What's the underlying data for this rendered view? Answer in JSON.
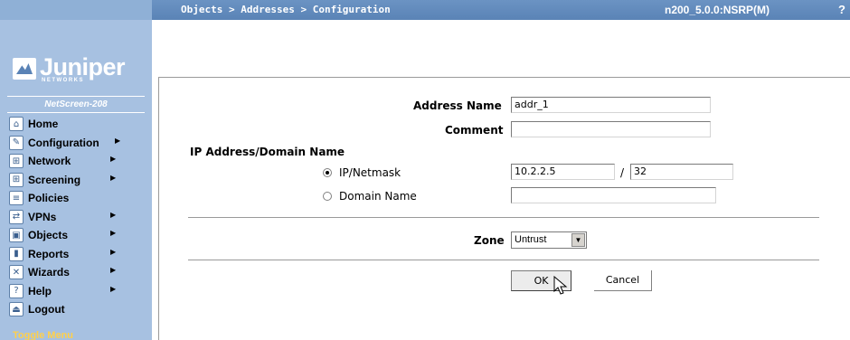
{
  "header": {
    "breadcrumb": "Objects > Addresses > Configuration",
    "version": "n200_5.0.0:NSRP(M)",
    "help_label": "?"
  },
  "sidebar": {
    "logo_text": "Juniper",
    "logo_sub": "NETWORKS",
    "device": "NetScreen-208",
    "items": [
      {
        "label": "Home",
        "icon": "home-icon"
      },
      {
        "label": "Configuration",
        "icon": "configuration-icon"
      },
      {
        "label": "Network",
        "icon": "network-icon"
      },
      {
        "label": "Screening",
        "icon": "screening-icon"
      },
      {
        "label": "Policies",
        "icon": "policies-icon"
      },
      {
        "label": "VPNs",
        "icon": "vpns-icon"
      },
      {
        "label": "Objects",
        "icon": "objects-icon"
      },
      {
        "label": "Reports",
        "icon": "reports-icon"
      },
      {
        "label": "Wizards",
        "icon": "wizards-icon"
      },
      {
        "label": "Help",
        "icon": "help-icon"
      },
      {
        "label": "Logout",
        "icon": "logout-icon"
      }
    ],
    "toggle_menu": "Toggle Menu"
  },
  "form": {
    "address_name_label": "Address Name",
    "address_name_value": "addr_1",
    "comment_label": "Comment",
    "comment_value": "",
    "section_label": "IP Address/Domain Name",
    "ip_netmask_label": "IP/Netmask",
    "ip_value": "10.2.2.5",
    "slash": "/",
    "netmask_value": "32",
    "domain_label": "Domain Name",
    "domain_value": "",
    "zone_label": "Zone",
    "zone_value": "Untrust",
    "ok_label": "OK",
    "cancel_label": "Cancel"
  },
  "colors": {
    "header_bg": "#5a83b6",
    "sidebar_bg": "#a7c1e1",
    "toggle_text": "#ffd04a"
  }
}
